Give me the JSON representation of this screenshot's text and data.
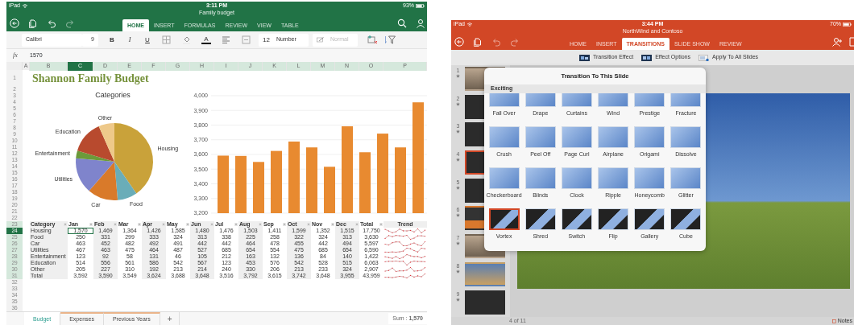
{
  "excel": {
    "status_bar": {
      "carrier": "iPad",
      "time": "3:11 PM",
      "battery": "93%"
    },
    "document_title": "Family budget",
    "ribbon_tabs": [
      {
        "label": "HOME",
        "selected": true
      },
      {
        "label": "INSERT",
        "selected": false
      },
      {
        "label": "FORMULAS",
        "selected": false
      },
      {
        "label": "REVIEW",
        "selected": false
      },
      {
        "label": "VIEW",
        "selected": false
      },
      {
        "label": "TABLE",
        "selected": false
      }
    ],
    "ribbon": {
      "font": "Calibri",
      "font_size": "9",
      "bold": "B",
      "italic": "I",
      "underline": "U",
      "font_color": "A",
      "number_format_icon": "12",
      "number_format": "Number",
      "cell_style": {
        "label": "Normal",
        "disabled": true
      }
    },
    "formula_bar": {
      "label": "fx",
      "value": "1570"
    },
    "columns": [
      {
        "label": "A",
        "highlighted": false,
        "selected": false
      },
      {
        "label": "B",
        "highlighted": true,
        "selected": false
      },
      {
        "label": "C",
        "highlighted": true,
        "selected": true
      },
      {
        "label": "D",
        "highlighted": true,
        "selected": false
      },
      {
        "label": "E",
        "highlighted": true,
        "selected": false
      },
      {
        "label": "F",
        "highlighted": true,
        "selected": false
      },
      {
        "label": "G",
        "highlighted": true,
        "selected": false
      },
      {
        "label": "H",
        "highlighted": true,
        "selected": false
      },
      {
        "label": "I",
        "highlighted": true,
        "selected": false
      },
      {
        "label": "J",
        "highlighted": true,
        "selected": false
      },
      {
        "label": "K",
        "highlighted": true,
        "selected": false
      },
      {
        "label": "L",
        "highlighted": true,
        "selected": false
      },
      {
        "label": "M",
        "highlighted": true,
        "selected": false
      },
      {
        "label": "N",
        "highlighted": true,
        "selected": false
      },
      {
        "label": "O",
        "highlighted": true,
        "selected": false
      },
      {
        "label": "P",
        "highlighted": true,
        "selected": false
      }
    ],
    "row_numbers": [
      {
        "label": "1",
        "highlighted": false,
        "selected": false
      },
      {
        "label": "2",
        "highlighted": false,
        "selected": false
      },
      {
        "label": "3",
        "highlighted": false,
        "selected": false
      },
      {
        "label": "4",
        "highlighted": false,
        "selected": false
      },
      {
        "label": "5",
        "highlighted": false,
        "selected": false
      },
      {
        "label": "6",
        "highlighted": false,
        "selected": false
      },
      {
        "label": "7",
        "highlighted": false,
        "selected": false
      },
      {
        "label": "8",
        "highlighted": false,
        "selected": false
      },
      {
        "label": "9",
        "highlighted": false,
        "selected": false
      },
      {
        "label": "10",
        "highlighted": false,
        "selected": false
      },
      {
        "label": "11",
        "highlighted": false,
        "selected": false
      },
      {
        "label": "12",
        "highlighted": false,
        "selected": false
      },
      {
        "label": "13",
        "highlighted": false,
        "selected": false
      },
      {
        "label": "14",
        "highlighted": false,
        "selected": false
      },
      {
        "label": "15",
        "highlighted": false,
        "selected": false
      },
      {
        "label": "16",
        "highlighted": false,
        "selected": false
      },
      {
        "label": "17",
        "highlighted": false,
        "selected": false
      },
      {
        "label": "18",
        "highlighted": false,
        "selected": false
      },
      {
        "label": "19",
        "highlighted": false,
        "selected": false
      },
      {
        "label": "20",
        "highlighted": false,
        "selected": false
      },
      {
        "label": "21",
        "highlighted": false,
        "selected": false
      },
      {
        "label": "22",
        "highlighted": false,
        "selected": false
      },
      {
        "label": "23",
        "highlighted": true,
        "selected": false
      },
      {
        "label": "24",
        "highlighted": true,
        "selected": true
      },
      {
        "label": "25",
        "highlighted": true,
        "selected": false
      },
      {
        "label": "26",
        "highlighted": true,
        "selected": false
      },
      {
        "label": "27",
        "highlighted": true,
        "selected": false
      },
      {
        "label": "28",
        "highlighted": true,
        "selected": false
      },
      {
        "label": "29",
        "highlighted": true,
        "selected": false
      },
      {
        "label": "30",
        "highlighted": true,
        "selected": false
      },
      {
        "label": "31",
        "highlighted": true,
        "selected": false
      },
      {
        "label": "32",
        "highlighted": false,
        "selected": false
      },
      {
        "label": "33",
        "highlighted": false,
        "selected": false
      },
      {
        "label": "34",
        "highlighted": false,
        "selected": false
      },
      {
        "label": "35",
        "highlighted": false,
        "selected": false
      },
      {
        "label": "36",
        "highlighted": false,
        "selected": false
      }
    ],
    "sheet_title": "Shannon Family Budget",
    "pie_chart": {
      "chart_data": {
        "type": "pie",
        "title": "Categories",
        "categories": [
          "Housing",
          "Food",
          "Car",
          "Utilities",
          "Entertainment",
          "Education",
          "Other"
        ],
        "values": [
          40.39,
          8.26,
          12.73,
          14.99,
          3.23,
          13.79,
          6.61
        ],
        "colors": [
          "#c9a23a",
          "#6aadb8",
          "#d97a2a",
          "#7f84cc",
          "#6b9a3a",
          "#b84a2e",
          "#eec98a"
        ]
      }
    },
    "bar_chart": {
      "chart_data": {
        "type": "bar",
        "grid": true,
        "color": "#e88a30",
        "ylim": [
          3200,
          4000
        ],
        "yticks": [
          {
            "value": 3200,
            "label": "3,200"
          },
          {
            "value": 3300,
            "label": "3,300"
          },
          {
            "value": 3400,
            "label": "3,400"
          },
          {
            "value": 3500,
            "label": "3,500"
          },
          {
            "value": 3600,
            "label": "3,600"
          },
          {
            "value": 3700,
            "label": "3,700"
          },
          {
            "value": 3800,
            "label": "3,800"
          },
          {
            "value": 3900,
            "label": "3,900"
          },
          {
            "value": 4000,
            "label": "4,000"
          }
        ],
        "values": [
          3592,
          3590,
          3549,
          3624,
          3688,
          3648,
          3516,
          3792,
          3615,
          3742,
          3648,
          3955
        ]
      }
    },
    "table": {
      "columns": [
        "Category",
        "Jan",
        "Feb",
        "Mar",
        "Apr",
        "May",
        "Jun",
        "Jul",
        "Aug",
        "Sep",
        "Oct",
        "Nov",
        "Dec",
        "Total",
        "Trend"
      ],
      "rows": [
        [
          "Housing",
          "1,570",
          "1,469",
          "1,364",
          "1,426",
          "1,585",
          "1,480",
          "1,476",
          "1,503",
          "1,411",
          "1,599",
          "1,352",
          "1,515",
          "17,750"
        ],
        [
          "Food",
          "250",
          "331",
          "299",
          "333",
          "324",
          "313",
          "338",
          "225",
          "258",
          "322",
          "324",
          "313",
          "3,630"
        ],
        [
          "Car",
          "463",
          "452",
          "482",
          "492",
          "491",
          "442",
          "442",
          "464",
          "478",
          "455",
          "442",
          "494",
          "5,597"
        ],
        [
          "Utilities",
          "467",
          "463",
          "475",
          "464",
          "487",
          "527",
          "685",
          "654",
          "554",
          "475",
          "685",
          "654",
          "6,590"
        ],
        [
          "Entertainment",
          "123",
          "92",
          "58",
          "131",
          "46",
          "105",
          "212",
          "163",
          "132",
          "136",
          "84",
          "140",
          "1,422"
        ],
        [
          "Education",
          "514",
          "556",
          "561",
          "586",
          "542",
          "567",
          "123",
          "453",
          "576",
          "542",
          "528",
          "515",
          "6,063"
        ],
        [
          "Other",
          "205",
          "227",
          "310",
          "192",
          "213",
          "214",
          "240",
          "330",
          "206",
          "213",
          "233",
          "324",
          "2,907"
        ],
        [
          "Total",
          "3,592",
          "3,590",
          "3,549",
          "3,624",
          "3,688",
          "3,648",
          "3,516",
          "3,792",
          "3,615",
          "3,742",
          "3,648",
          "3,955",
          "43,959"
        ]
      ]
    },
    "sheet_tabs": [
      {
        "label": "Budget",
        "selected": true
      },
      {
        "label": "Expenses",
        "selected": false
      },
      {
        "label": "Previous Years",
        "selected": false
      }
    ],
    "add_sheet": "+",
    "status": "Sum : **1,570**"
  },
  "powerpoint": {
    "status_bar": {
      "carrier": "iPad",
      "time": "3:44 PM",
      "battery": "70%"
    },
    "document_title": "NorthWind and Contoso",
    "ribbon_tabs": [
      {
        "label": "HOME",
        "selected": false
      },
      {
        "label": "INSERT",
        "selected": false
      },
      {
        "label": "TRANSITIONS",
        "selected": true
      },
      {
        "label": "SLIDE SHOW",
        "selected": false
      },
      {
        "label": "REVIEW",
        "selected": false
      }
    ],
    "ribbon_buttons": [
      "Transition Effect",
      "Effect Options",
      "Apply To All Slides"
    ],
    "slides": [
      {
        "number": "1",
        "selected": false
      },
      {
        "number": "2",
        "selected": false
      },
      {
        "number": "3",
        "selected": false
      },
      {
        "number": "4",
        "selected": true
      },
      {
        "number": "5",
        "selected": false
      },
      {
        "number": "6",
        "selected": false
      },
      {
        "number": "7",
        "selected": false
      },
      {
        "number": "8",
        "selected": false
      },
      {
        "number": "9",
        "selected": false
      }
    ],
    "transition_panel": {
      "title": "Transition To This Slide",
      "section": "Exciting",
      "options": [
        {
          "label": "Fall Over",
          "selected": false
        },
        {
          "label": "Drape",
          "selected": false
        },
        {
          "label": "Curtains",
          "selected": false
        },
        {
          "label": "Wind",
          "selected": false
        },
        {
          "label": "Prestige",
          "selected": false
        },
        {
          "label": "Fracture",
          "selected": false
        },
        {
          "label": "Crush",
          "selected": false
        },
        {
          "label": "Peel Off",
          "selected": false
        },
        {
          "label": "Page Curl",
          "selected": false
        },
        {
          "label": "Airplane",
          "selected": false
        },
        {
          "label": "Origami",
          "selected": false
        },
        {
          "label": "Dissolve",
          "selected": false
        },
        {
          "label": "Checkerboard",
          "selected": false
        },
        {
          "label": "Blinds",
          "selected": false
        },
        {
          "label": "Clock",
          "selected": false
        },
        {
          "label": "Ripple",
          "selected": false
        },
        {
          "label": "Honeycomb",
          "selected": false
        },
        {
          "label": "Glitter",
          "selected": false
        },
        {
          "label": "Vortex",
          "selected": true
        },
        {
          "label": "Shred",
          "selected": false
        },
        {
          "label": "Switch",
          "selected": false
        },
        {
          "label": "Flip",
          "selected": false
        },
        {
          "label": "Gallery",
          "selected": false
        },
        {
          "label": "Cube",
          "selected": false
        }
      ]
    },
    "footer": {
      "slide_position": "4 of 11",
      "notes": "Notes"
    }
  }
}
